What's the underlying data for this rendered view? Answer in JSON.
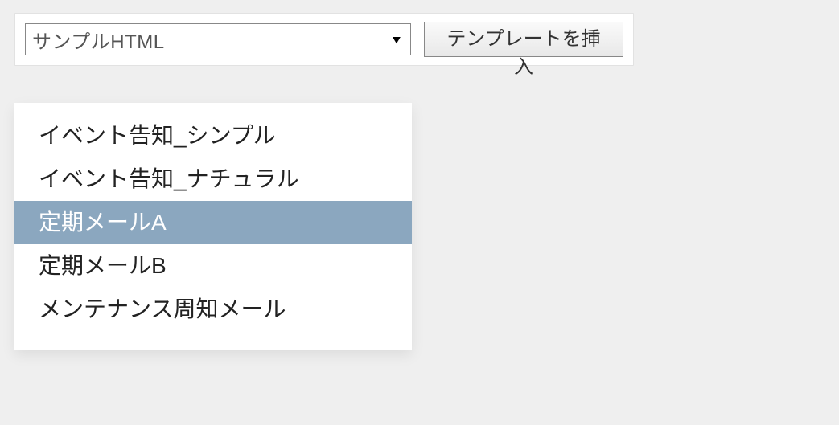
{
  "toolbar": {
    "select_value": "サンプルHTML",
    "insert_button_label": "テンプレートを挿入"
  },
  "dropdown": {
    "items": [
      {
        "label": "イベント告知_シンプル",
        "highlighted": false
      },
      {
        "label": "イベント告知_ナチュラル",
        "highlighted": false
      },
      {
        "label": "定期メールA",
        "highlighted": true
      },
      {
        "label": "定期メールB",
        "highlighted": false
      },
      {
        "label": "メンテナンス周知メール",
        "highlighted": false
      }
    ]
  }
}
